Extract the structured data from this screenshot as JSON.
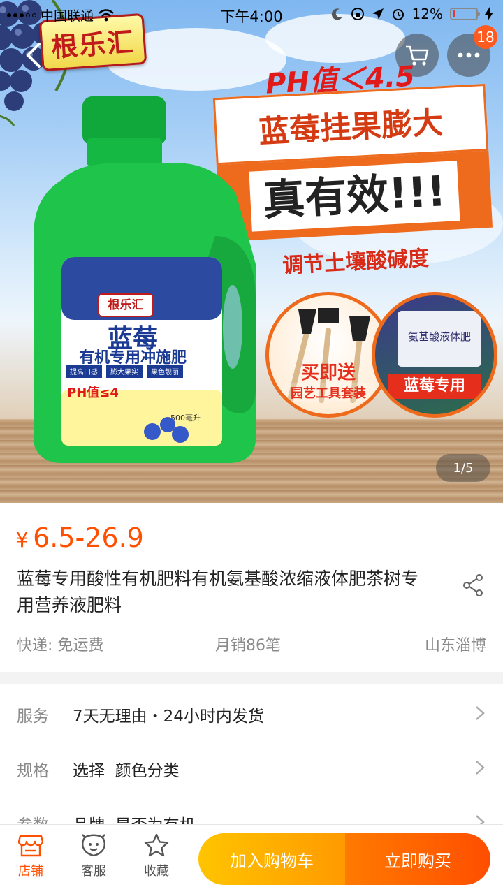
{
  "status_bar": {
    "carrier": "中国联通",
    "time": "下午4:00",
    "battery": "12%",
    "battery_level": 0.12
  },
  "hero": {
    "brand": "根乐汇",
    "ph_text": "PH值＜4.5",
    "promo_line1": "蓝莓挂果膨大",
    "promo_line2": "真有效!!!",
    "adjust_text": "调节土壤酸碱度",
    "gift_label": "买即送",
    "gift_sub": "园艺工具套装",
    "bag_label": "蓝莓专用",
    "bag_title": "氨基酸液体肥",
    "bottle_brand": "根乐汇",
    "bottle_title": "蓝莓",
    "bottle_subtitle": "有机专用冲施肥",
    "bottle_tags": [
      "提高口感",
      "膨大果实",
      "果色靓丽"
    ],
    "bottle_ph": "PH值≤4",
    "bottle_volume": "500毫升",
    "cart_badge": "18",
    "page_indicator": "1/5",
    "colors": {
      "accent": "#ee6a1c",
      "brand_red": "#c01a1a",
      "bottle_green": "#1fc44a"
    }
  },
  "product": {
    "currency": "¥",
    "price": "6.5-26.9",
    "title": "蓝莓专用酸性有机肥料有机氨基酸浓缩液体肥茶树专用营养液肥料",
    "shipping": "快递: 免运费",
    "monthly_sales": "月销86笔",
    "location": "山东淄博",
    "price_color": "#ff5000"
  },
  "details": [
    {
      "key": "服务",
      "value": "7天无理由・24小时内发货"
    },
    {
      "key": "规格",
      "value": "选择  颜色分类"
    },
    {
      "key": "参数",
      "value": "品牌  是否为有机"
    }
  ],
  "bottom_bar": {
    "shop": "店铺",
    "service": "客服",
    "favorite": "收藏",
    "add_to_cart": "加入购物车",
    "buy_now": "立即购买"
  },
  "icons": [
    "back-icon",
    "cart-icon",
    "more-icon",
    "share-icon",
    "chevron-right-icon",
    "shop-icon",
    "customer-service-icon",
    "star-icon"
  ]
}
